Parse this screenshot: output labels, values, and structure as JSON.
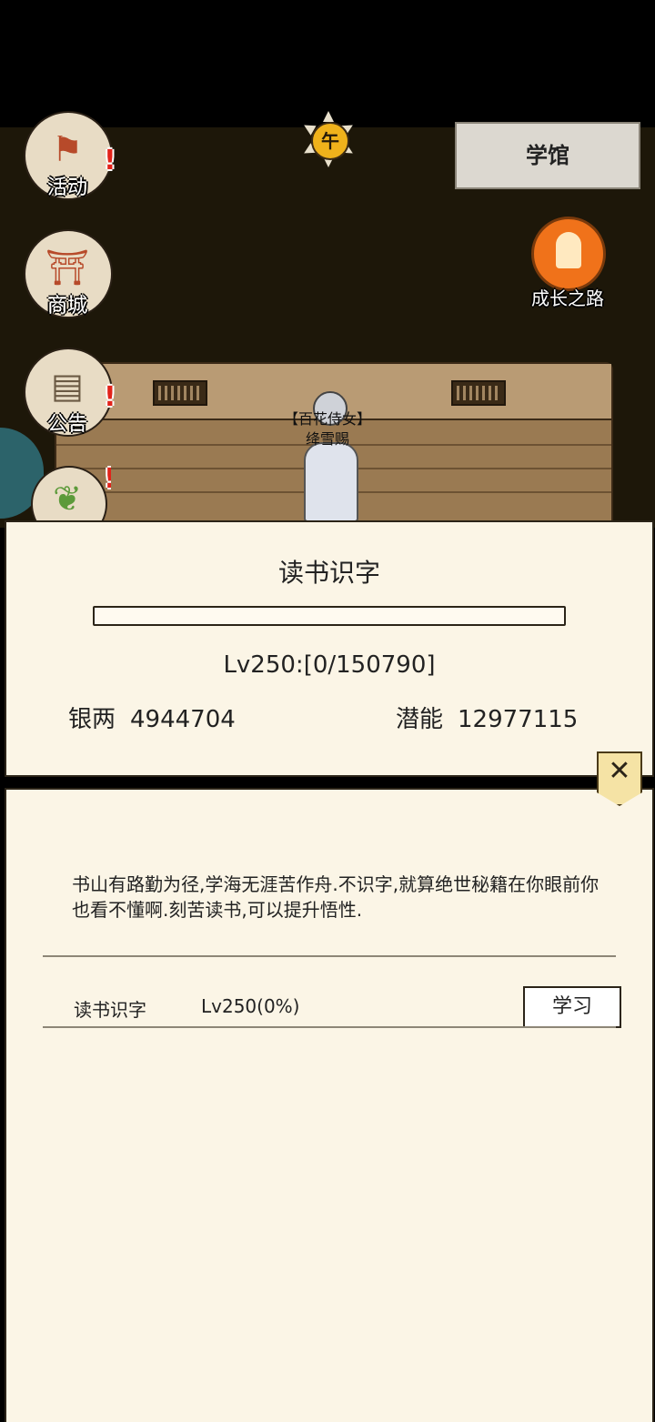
{
  "hud": {
    "time_glyph": "午",
    "location": "学馆",
    "buttons": [
      {
        "label": "活动",
        "icon": "flag-icon",
        "alert": "!"
      },
      {
        "label": "商城",
        "icon": "shop-icon"
      },
      {
        "label": "公告",
        "icon": "notice-icon",
        "alert": "!"
      },
      {
        "label": "",
        "icon": "tree-icon",
        "alert": "!"
      }
    ],
    "growth_label": "成长之路"
  },
  "npc": {
    "title": "【百花侍女】",
    "name": "绛雪赐"
  },
  "panel": {
    "title": "读书识字",
    "progress_fraction": 0,
    "level_line": "Lv250:[0/150790]",
    "silver_label": "银两",
    "silver_value": "4944704",
    "potential_label": "潜能",
    "potential_value": "12977115"
  },
  "detail": {
    "description": "书山有路勤为径,学海无涯苦作舟.不识字,就算绝世秘籍在你眼前你也看不懂啊.刻苦读书,可以提升悟性.",
    "skill_label": "读书识字",
    "skill_level": "Lv250(0%)",
    "learn_button": "学习",
    "close_glyph": "✕"
  }
}
